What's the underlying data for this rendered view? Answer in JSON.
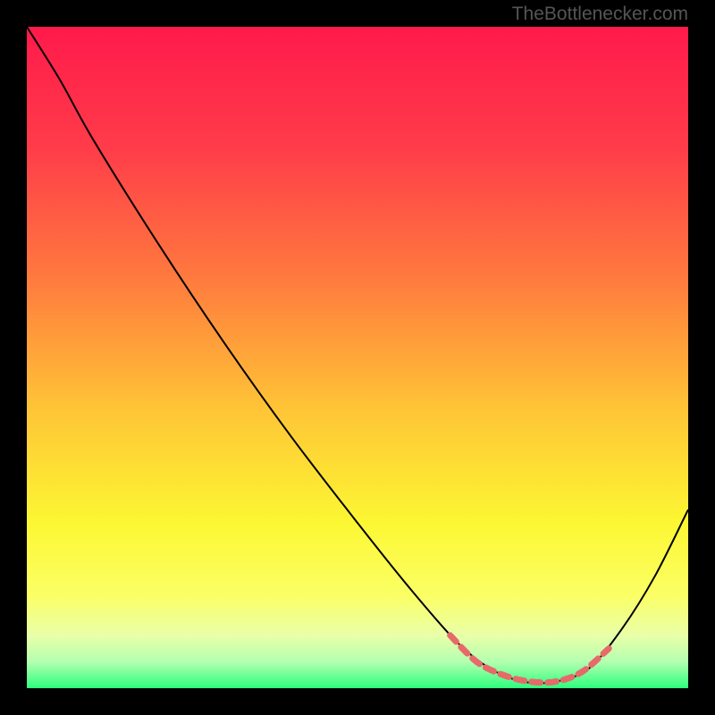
{
  "watermark": "TheBottlenecker.com",
  "chart_data": {
    "type": "line",
    "title": "",
    "xlabel": "",
    "ylabel": "",
    "xlim": [
      0,
      100
    ],
    "ylim": [
      0,
      100
    ],
    "gradient_stops": [
      {
        "offset": 0,
        "color": "#ff1a4b"
      },
      {
        "offset": 18,
        "color": "#ff3b4a"
      },
      {
        "offset": 38,
        "color": "#ff7a3e"
      },
      {
        "offset": 58,
        "color": "#ffc536"
      },
      {
        "offset": 75,
        "color": "#fcf733"
      },
      {
        "offset": 86,
        "color": "#fbff65"
      },
      {
        "offset": 92,
        "color": "#e9ffa8"
      },
      {
        "offset": 96,
        "color": "#b4ffb0"
      },
      {
        "offset": 100,
        "color": "#2dff7c"
      }
    ],
    "series": [
      {
        "name": "main-curve",
        "color": "#000000",
        "width": 2,
        "points": [
          {
            "x": 0,
            "y": 100
          },
          {
            "x": 5,
            "y": 92
          },
          {
            "x": 10,
            "y": 83
          },
          {
            "x": 20,
            "y": 67
          },
          {
            "x": 30,
            "y": 52
          },
          {
            "x": 40,
            "y": 38
          },
          {
            "x": 50,
            "y": 25
          },
          {
            "x": 58,
            "y": 15
          },
          {
            "x": 65,
            "y": 7
          },
          {
            "x": 70,
            "y": 3
          },
          {
            "x": 75,
            "y": 1
          },
          {
            "x": 80,
            "y": 1
          },
          {
            "x": 85,
            "y": 3
          },
          {
            "x": 90,
            "y": 9
          },
          {
            "x": 95,
            "y": 17
          },
          {
            "x": 100,
            "y": 27
          }
        ]
      },
      {
        "name": "highlight-segment",
        "color": "#e76a6a",
        "width": 7,
        "dash": "10,8",
        "points": [
          {
            "x": 64,
            "y": 8
          },
          {
            "x": 68,
            "y": 4
          },
          {
            "x": 72,
            "y": 2
          },
          {
            "x": 76,
            "y": 1
          },
          {
            "x": 80,
            "y": 1
          },
          {
            "x": 84,
            "y": 2.5
          },
          {
            "x": 88,
            "y": 6
          }
        ]
      }
    ]
  }
}
